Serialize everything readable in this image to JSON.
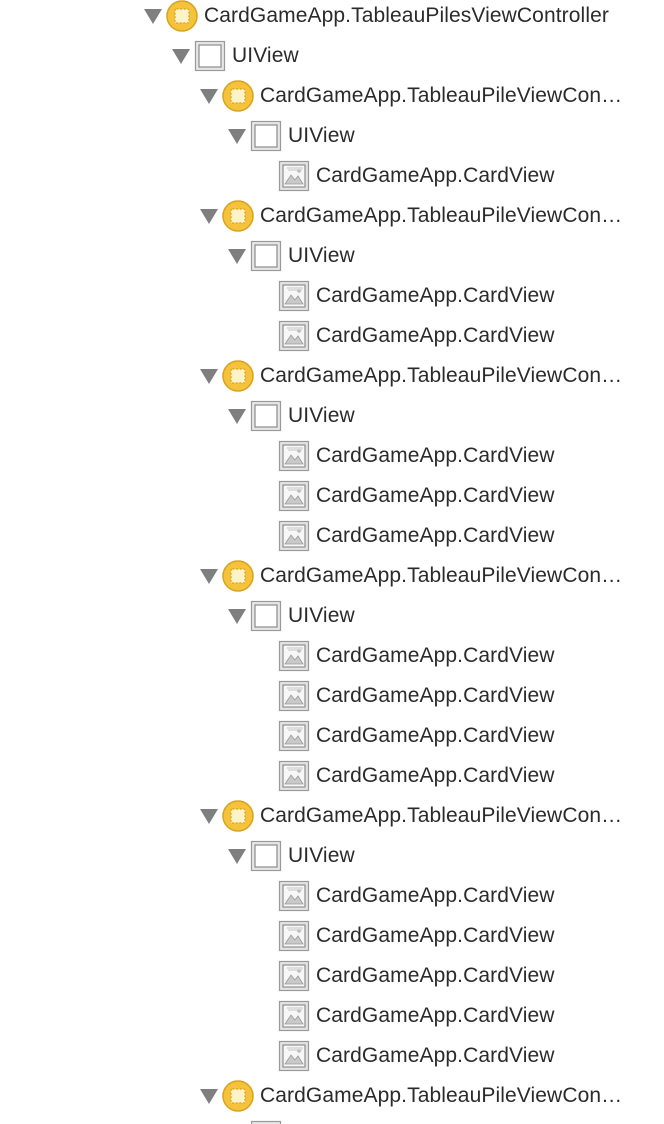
{
  "colors": {
    "disclosure": "#7f7f7f",
    "text": "#2b2b2b",
    "controller_icon_fill": "#f5c33b",
    "controller_icon_border": "#d8a21d",
    "view_icon_border": "#8a8a8a",
    "image_icon_border": "#8f8f8f"
  },
  "tree": [
    {
      "depth": 0,
      "type": "controller",
      "icon": "view-controller-icon",
      "expanded": true,
      "label": "CardGameApp.TableauPilesViewController"
    },
    {
      "depth": 1,
      "type": "view",
      "icon": "view-icon",
      "expanded": true,
      "label": "UIView"
    },
    {
      "depth": 2,
      "type": "controller",
      "icon": "view-controller-icon",
      "expanded": true,
      "label": "CardGameApp.TableauPileViewCon…"
    },
    {
      "depth": 3,
      "type": "view",
      "icon": "view-icon",
      "expanded": true,
      "label": "UIView"
    },
    {
      "depth": 4,
      "type": "card",
      "icon": "image-view-icon",
      "expanded": false,
      "label": "CardGameApp.CardView"
    },
    {
      "depth": 2,
      "type": "controller",
      "icon": "view-controller-icon",
      "expanded": true,
      "label": "CardGameApp.TableauPileViewCon…"
    },
    {
      "depth": 3,
      "type": "view",
      "icon": "view-icon",
      "expanded": true,
      "label": "UIView"
    },
    {
      "depth": 4,
      "type": "card",
      "icon": "image-view-icon",
      "expanded": false,
      "label": "CardGameApp.CardView"
    },
    {
      "depth": 4,
      "type": "card",
      "icon": "image-view-icon",
      "expanded": false,
      "label": "CardGameApp.CardView"
    },
    {
      "depth": 2,
      "type": "controller",
      "icon": "view-controller-icon",
      "expanded": true,
      "label": "CardGameApp.TableauPileViewCon…"
    },
    {
      "depth": 3,
      "type": "view",
      "icon": "view-icon",
      "expanded": true,
      "label": "UIView"
    },
    {
      "depth": 4,
      "type": "card",
      "icon": "image-view-icon",
      "expanded": false,
      "label": "CardGameApp.CardView"
    },
    {
      "depth": 4,
      "type": "card",
      "icon": "image-view-icon",
      "expanded": false,
      "label": "CardGameApp.CardView"
    },
    {
      "depth": 4,
      "type": "card",
      "icon": "image-view-icon",
      "expanded": false,
      "label": "CardGameApp.CardView"
    },
    {
      "depth": 2,
      "type": "controller",
      "icon": "view-controller-icon",
      "expanded": true,
      "label": "CardGameApp.TableauPileViewCon…"
    },
    {
      "depth": 3,
      "type": "view",
      "icon": "view-icon",
      "expanded": true,
      "label": "UIView"
    },
    {
      "depth": 4,
      "type": "card",
      "icon": "image-view-icon",
      "expanded": false,
      "label": "CardGameApp.CardView"
    },
    {
      "depth": 4,
      "type": "card",
      "icon": "image-view-icon",
      "expanded": false,
      "label": "CardGameApp.CardView"
    },
    {
      "depth": 4,
      "type": "card",
      "icon": "image-view-icon",
      "expanded": false,
      "label": "CardGameApp.CardView"
    },
    {
      "depth": 4,
      "type": "card",
      "icon": "image-view-icon",
      "expanded": false,
      "label": "CardGameApp.CardView"
    },
    {
      "depth": 2,
      "type": "controller",
      "icon": "view-controller-icon",
      "expanded": true,
      "label": "CardGameApp.TableauPileViewCon…"
    },
    {
      "depth": 3,
      "type": "view",
      "icon": "view-icon",
      "expanded": true,
      "label": "UIView"
    },
    {
      "depth": 4,
      "type": "card",
      "icon": "image-view-icon",
      "expanded": false,
      "label": "CardGameApp.CardView"
    },
    {
      "depth": 4,
      "type": "card",
      "icon": "image-view-icon",
      "expanded": false,
      "label": "CardGameApp.CardView"
    },
    {
      "depth": 4,
      "type": "card",
      "icon": "image-view-icon",
      "expanded": false,
      "label": "CardGameApp.CardView"
    },
    {
      "depth": 4,
      "type": "card",
      "icon": "image-view-icon",
      "expanded": false,
      "label": "CardGameApp.CardView"
    },
    {
      "depth": 4,
      "type": "card",
      "icon": "image-view-icon",
      "expanded": false,
      "label": "CardGameApp.CardView"
    },
    {
      "depth": 2,
      "type": "controller",
      "icon": "view-controller-icon",
      "expanded": true,
      "label": "CardGameApp.TableauPileViewCon…"
    },
    {
      "depth": 3,
      "type": "view",
      "icon": "view-icon",
      "expanded": false,
      "label": ""
    }
  ]
}
